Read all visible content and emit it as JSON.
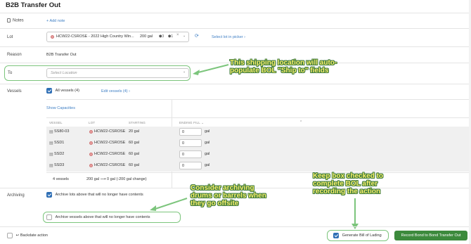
{
  "page": {
    "title": "B2B Transfer Out"
  },
  "notes": {
    "label": "Notes",
    "add_note": "Add note"
  },
  "lot": {
    "label": "Lot",
    "selected": "HCW22-CSROSE - 2022 High Country Win...",
    "volume": "200 gal",
    "badge_a": "3",
    "badge_b": "1",
    "select_in_picker": "Select lot in picker"
  },
  "reason": {
    "label": "Reason",
    "value": "B2B Transfer Out"
  },
  "to": {
    "label": "To",
    "placeholder": "Select Location"
  },
  "vessels": {
    "label": "Vessels",
    "all_vessels": "All vessels (4)",
    "edit_vessels": "Edit vessels (4)",
    "show_capacities": "Show Capacities",
    "headers": {
      "vessel": "VESSEL",
      "lot": "LOT",
      "starting": "STARTING",
      "ending_fill": "ENDING FILL"
    },
    "rows": [
      {
        "vessel": "SS80-03",
        "lot": "HCW22-CSROSE",
        "starting": "20 gal",
        "ending": "0",
        "unit": "gal"
      },
      {
        "vessel": "SSD1",
        "lot": "HCW22-CSROSE",
        "starting": "60 gal",
        "ending": "0",
        "unit": "gal"
      },
      {
        "vessel": "SSD2",
        "lot": "HCW22-CSROSE",
        "starting": "60 gal",
        "ending": "0",
        "unit": "gal"
      },
      {
        "vessel": "SSD3",
        "lot": "HCW22-CSROSE",
        "starting": "60 gal",
        "ending": "0",
        "unit": "gal"
      }
    ],
    "summary_count": "4 vessels",
    "summary_change": "200 gal ⟶ 0 gal (-200 gal change)"
  },
  "archiving": {
    "label": "Archiving",
    "archive_lots": "Archive lots above that will no longer have contents",
    "archive_vessels": "Archive vessels above that will no longer have contents"
  },
  "footer": {
    "backdate": "Backdate action",
    "generate_bol": "Generate Bill of Lading",
    "record_button": "Record Bond to Bond Transfer Out"
  },
  "annotations": {
    "shipping": "This shipping location will auto-populate BOL \"Ship to\" fields",
    "archiving": "Consider archiving drums or barrels when they go offsite",
    "bol": "Keep box checked to complete BOL after recording the action"
  },
  "colors": {
    "accent": "#2f6fb5",
    "annotation_text": "#f7ee6b",
    "annotation_outline": "#3d7a3d",
    "highlight": "#7cc57c",
    "primary_button": "#3c8a3c"
  }
}
